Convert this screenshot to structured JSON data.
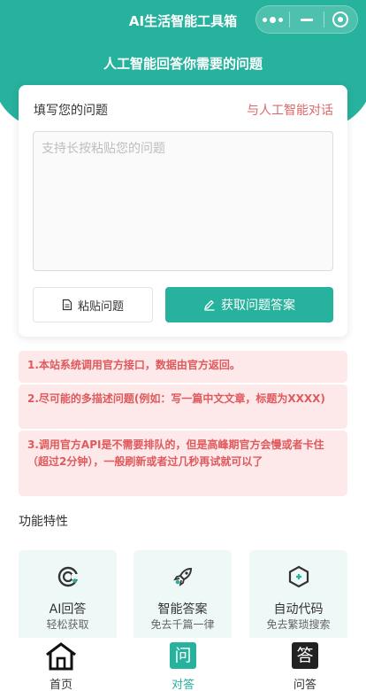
{
  "header": {
    "title": "AI生活智能工具箱",
    "subtitle": "人工智能回答你需要的问题",
    "capsule": {
      "more_icon": "more-dots-icon",
      "minimize_icon": "minimize-icon",
      "close_icon": "target-icon"
    }
  },
  "question_card": {
    "label": "填写您的问题",
    "chat_link": "与人工智能对话",
    "placeholder": "支持长按粘贴您的问题",
    "value": "",
    "paste_button": "粘贴问题",
    "answer_button": "获取问题答案"
  },
  "notices": [
    "1.本站系统调用官方接口，数据由官方返回。",
    "2.尽可能的多描述问题(例如：写一篇中文文章，标题为XXXX)",
    "3.调用官方API是不需要排队的，但是高峰期官方会慢或者卡住（超过2分钟），一般刷新或者过几秒再试就可以了"
  ],
  "features": {
    "title": "功能特性",
    "items": [
      {
        "title": "AI回答",
        "subtitle": "轻松获取",
        "icon": "ai-logo-icon"
      },
      {
        "title": "智能答案",
        "subtitle": "免去千篇一律",
        "icon": "rocket-icon"
      },
      {
        "title": "自动代码",
        "subtitle": "免去繁琐搜索",
        "icon": "hexagon-icon"
      }
    ]
  },
  "tabbar": {
    "items": [
      {
        "label": "首页",
        "icon": "home-icon"
      },
      {
        "label": "对答",
        "icon_text": "问",
        "active": true
      },
      {
        "label": "问答",
        "icon_text": "答"
      }
    ]
  },
  "colors": {
    "primary": "#26b29d",
    "notice_bg": "#fde9e9",
    "notice_text": "#e0595c",
    "link": "#d9686a"
  }
}
